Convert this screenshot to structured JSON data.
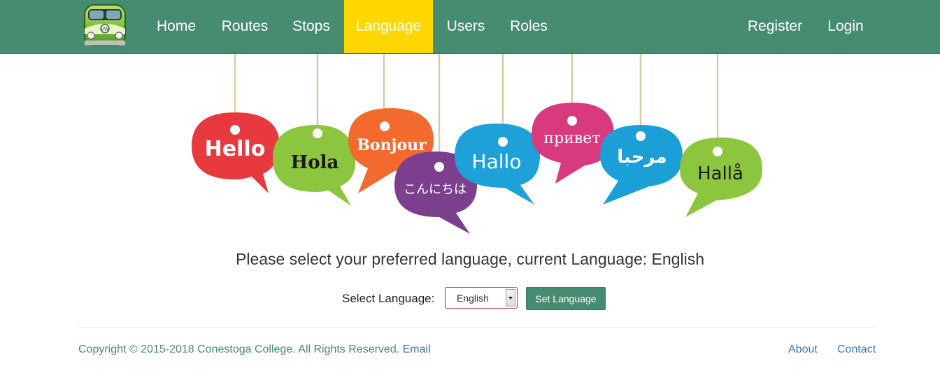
{
  "nav": {
    "items": [
      {
        "label": "Home"
      },
      {
        "label": "Routes"
      },
      {
        "label": "Stops"
      },
      {
        "label": "Language",
        "active": true
      },
      {
        "label": "Users"
      },
      {
        "label": "Roles"
      }
    ],
    "right_items": [
      {
        "label": "Register"
      },
      {
        "label": "Login"
      }
    ],
    "logo_icon": "vw-bus-icon",
    "bg_color": "#468c70",
    "active_color": "#ffd700"
  },
  "hero": {
    "icon": "language-speech-bubbles-banner",
    "bubbles": [
      {
        "text": "Hello",
        "color": "#e8393f"
      },
      {
        "text": "Hola",
        "color": "#8cc63f"
      },
      {
        "text": "Bonjour",
        "color": "#f26a2e"
      },
      {
        "text": "こんにちは",
        "color": "#7b3f8e"
      },
      {
        "text": "Hallo",
        "color": "#1ea1d9"
      },
      {
        "text": "привет",
        "color": "#d93a7e"
      },
      {
        "text": "مرحبا",
        "color": "#1a9fd6"
      },
      {
        "text": "Hallå",
        "color": "#8cc63f"
      }
    ]
  },
  "main": {
    "prompt": "Please select your preferred language, current Language: English",
    "select_label": "Select Language:",
    "select_value": "English",
    "set_button": "Set Language"
  },
  "footer": {
    "copyright": "Copyright © 2015-2018 Conestoga College. All Rights Reserved. ",
    "email_link": "Email",
    "about": "About",
    "contact": "Contact"
  }
}
